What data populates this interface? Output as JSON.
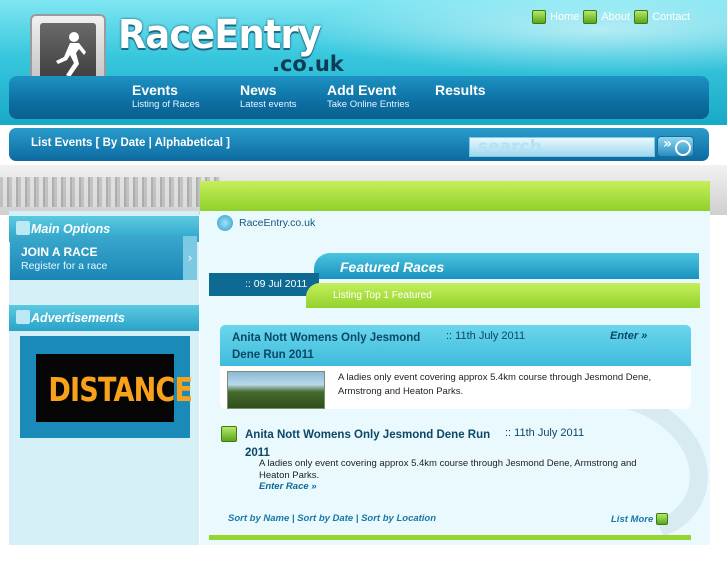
{
  "brand": {
    "name": "RaceEntry",
    "tld": ".co.uk"
  },
  "toplinks": [
    {
      "label": "Home",
      "icon": "home-icon"
    },
    {
      "label": "About",
      "icon": "about-icon"
    },
    {
      "label": "Contact",
      "icon": "contact-icon"
    }
  ],
  "nav": [
    {
      "title": "Events",
      "sub": "Listing of Races"
    },
    {
      "title": "News",
      "sub": "Latest events"
    },
    {
      "title": "Add Event",
      "sub": "Take Online Entries"
    },
    {
      "title": "Results",
      "sub": ""
    }
  ],
  "listbar": {
    "prefix": "List Events [ ",
    "by_date": "By Date",
    "sep": " | ",
    "alpha": "Alphabetical",
    "suffix": " ]"
  },
  "search": {
    "placeholder": "search"
  },
  "sidebar": {
    "main_options": "Main Options",
    "join_title": "JOIN A RACE",
    "join_sub": "Register for a race",
    "advertisements": "Advertisements",
    "ad_text": "DISTANCE"
  },
  "breadcrumb": "RaceEntry.co.uk",
  "featured": {
    "heading": "Featured Races",
    "date": ":: 09 Jul 2011",
    "listing": "Listing Top 1 Featured",
    "item": {
      "title": "Anita Nott Womens Only Jesmond Dene Run 2011",
      "date": ":: 11th July 2011",
      "enter": "Enter »",
      "desc": "A ladies only event covering approx 5.4km course through Jesmond Dene, Armstrong and Heaton Parks."
    }
  },
  "race": {
    "title": "Anita Nott Womens Only Jesmond Dene Run 2011",
    "date": ":: 11th July 2011",
    "desc": "A ladies only event covering approx 5.4km course through Jesmond Dene, Armstrong and Heaton Parks.",
    "enter": "Enter Race »"
  },
  "sorts": {
    "name": "Sort by Name",
    "date": "Sort by Date",
    "location": "Sort by Location",
    "sep": " | "
  },
  "list_more": "List More"
}
